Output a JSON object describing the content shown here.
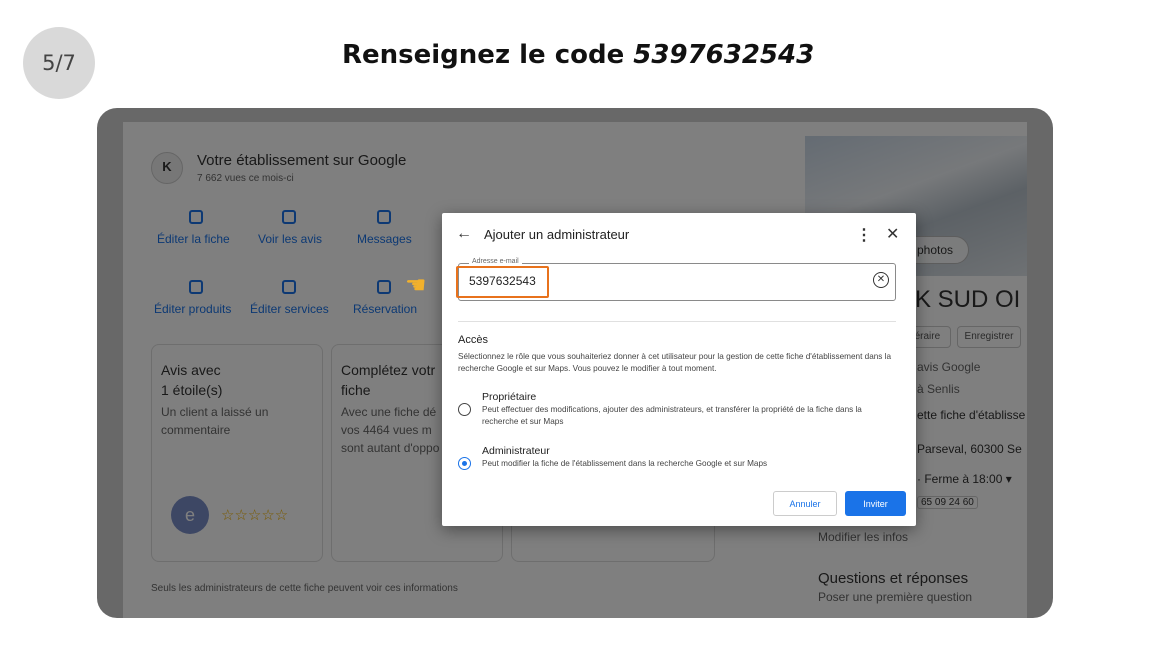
{
  "step": "5/7",
  "headline": {
    "prefix": "Renseignez le code ",
    "code": "5397632543"
  },
  "background": {
    "business_avatar": "K",
    "business_title": "Votre établissement sur Google",
    "views": "7 662 vues ce mois-ci",
    "actions_row1": [
      "Éditer la fiche",
      "Voir les avis",
      "Messages"
    ],
    "actions_row2": [
      "Éditer produits",
      "Éditer services",
      "Réservation"
    ],
    "card1": {
      "title": "Avis avec",
      "subtitle": "1 étoile(s)",
      "text1": "Un client a laissé un",
      "text2": "commentaire"
    },
    "card2": {
      "title": "Complétez votr",
      "subtitle": "fiche",
      "text1": "Avec une fiche dé",
      "text2": "vos 4464 vues m",
      "text3": "sont autant d'oppo"
    },
    "review_avatar": "e",
    "stars": "☆☆☆☆☆",
    "footer_note": "Seuls les administrateurs de cette fiche peuvent voir ces informations",
    "photos_label": "photos",
    "business_name_fragment": "K SUD OI",
    "chip_itinerary": "itinéraire",
    "chip_save": "Enregistrer",
    "right_lines": [
      "avis Google",
      "à Senlis",
      "ette fiche d'établisse",
      "Parseval, 60300 Se",
      "· Ferme à 18:00 ▾",
      "65 09 24 60"
    ],
    "modify_info": "Modifier les infos",
    "qa_title": "Questions et réponses",
    "qa_sub": "Poser une première question"
  },
  "dialog": {
    "title": "Ajouter un administrateur",
    "email_label": "Adresse e-mail",
    "email_value": "5397632543",
    "access_title": "Accès",
    "access_desc": "Sélectionnez le rôle que vous souhaiteriez donner à cet utilisateur pour la gestion de cette fiche d'établissement dans la recherche Google et sur Maps. Vous pouvez le modifier à tout moment.",
    "options": [
      {
        "title": "Propriétaire",
        "desc": "Peut effectuer des modifications, ajouter des administrateurs, et transférer la propriété de la fiche dans la recherche et sur Maps",
        "checked": false
      },
      {
        "title": "Administrateur",
        "desc": "Peut modifier la fiche de l'établissement dans la recherche Google et sur Maps",
        "checked": true
      }
    ],
    "cancel_label": "Annuler",
    "invite_label": "Inviter"
  },
  "colors": {
    "accent": "#1a73e8",
    "highlight": "#e8721c",
    "frame": "#686868"
  },
  "icons": [
    "back-arrow-icon",
    "more-vert-icon",
    "close-icon",
    "clear-icon",
    "pointing-hand-icon"
  ]
}
